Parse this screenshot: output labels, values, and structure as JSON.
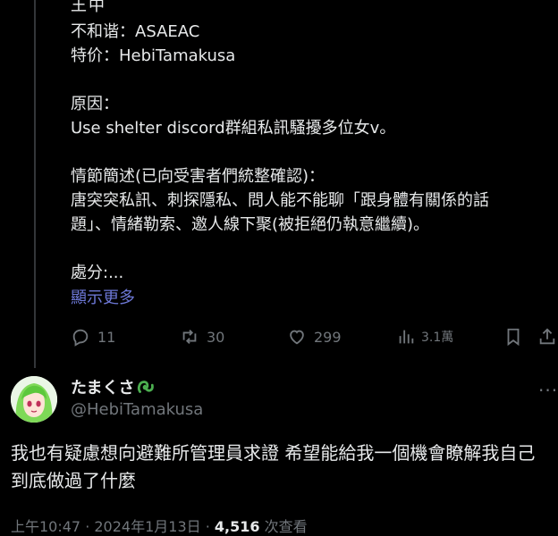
{
  "quoted_tweet": {
    "top_cut_text": "王中",
    "lines": [
      "不和谐：ASAEAC",
      "特价：HebiTamakusa",
      "",
      "原因：",
      "Use shelter discord群組私訊騷擾多位女v。",
      "",
      "情節簡述(已向受害者們統整確認)：",
      "唐突突私訊、刺探隱私、問人能不能聊「跟身體有關係的話",
      "題」、情緒勒索、邀人線下聚(被拒絕仍執意繼續)。",
      "",
      "處分:..."
    ],
    "show_more": "顯示更多",
    "stats": {
      "replies": "11",
      "retweets": "30",
      "likes": "299",
      "views": "3.1萬"
    }
  },
  "reply": {
    "display_name": "たまくさ",
    "handle": "@HebiTamakusa",
    "text": "我也有疑慮想向避難所管理員求證 希望能給我一個機會瞭解我自己到底做過了什麼",
    "timestamp_prefix": "上午10:47 · 2024年1月13日 · ",
    "views_count": "4,516",
    "views_suffix": " 次查看"
  },
  "colors": {
    "background": "#000000",
    "text": "#e7e9ea",
    "muted": "#71767b",
    "link": "#6d78d6"
  },
  "icons": [
    "reply-icon",
    "retweet-icon",
    "like-icon",
    "views-icon",
    "bookmark-icon",
    "share-icon",
    "more-icon",
    "green-snake-emoji"
  ]
}
